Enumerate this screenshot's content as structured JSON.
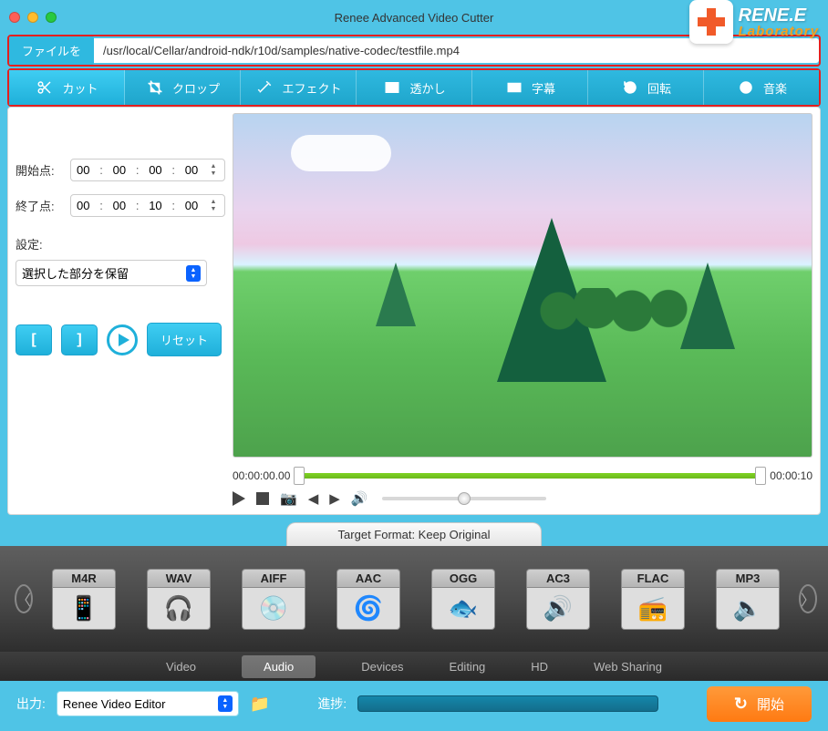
{
  "titlebar": {
    "title": "Renee Advanced Video Cutter"
  },
  "brand": {
    "name": "RENE.E",
    "sub": "Laboratory"
  },
  "filebar": {
    "button": "ファイルを",
    "path": "/usr/local/Cellar/android-ndk/r10d/samples/native-codec/testfile.mp4"
  },
  "tabs": [
    {
      "label": "カット",
      "icon": "scissors",
      "active": true
    },
    {
      "label": "クロップ",
      "icon": "crop"
    },
    {
      "label": "エフェクト",
      "icon": "wand"
    },
    {
      "label": "透かし",
      "icon": "watermark"
    },
    {
      "label": "字幕",
      "icon": "subtitle"
    },
    {
      "label": "回転",
      "icon": "rotate"
    },
    {
      "label": "音楽",
      "icon": "music"
    }
  ],
  "side": {
    "start_label": "開始点:",
    "start_time": {
      "h": "00",
      "m": "00",
      "s": "00",
      "f": "00"
    },
    "end_label": "終了点:",
    "end_time": {
      "h": "00",
      "m": "00",
      "s": "10",
      "f": "00"
    },
    "setting_label": "設定:",
    "setting_option": "選択した部分を保留",
    "mark_in": "[",
    "mark_out": "]",
    "reset": "リセット"
  },
  "timeline": {
    "start": "00:00:00.00",
    "end": "00:00:10"
  },
  "target": {
    "label": "Target Format: Keep Original"
  },
  "formats": [
    "M4R",
    "WAV",
    "AIFF",
    "AAC",
    "OGG",
    "AC3",
    "FLAC",
    "MP3"
  ],
  "categories": [
    {
      "label": "Video"
    },
    {
      "label": "Audio",
      "active": true
    },
    {
      "label": "Devices"
    },
    {
      "label": "Editing"
    },
    {
      "label": "HD"
    },
    {
      "label": "Web Sharing"
    }
  ],
  "bottom": {
    "out_label": "出力:",
    "out_value": "Renee Video Editor",
    "progress_label": "進捗:",
    "start": "開始"
  }
}
